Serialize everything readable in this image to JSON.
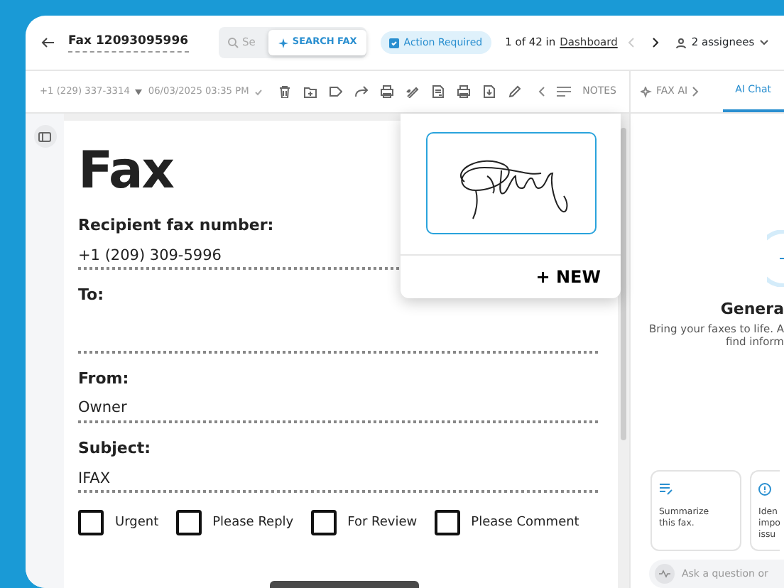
{
  "header": {
    "title": "Fax 12093095996",
    "search": {
      "placeholder": "Se",
      "button": "SEARCH FAX"
    },
    "status_badge": "Action Required",
    "pager": {
      "text": "1 of 42 in",
      "link": "Dashboard",
      "prev_disabled": true,
      "next_disabled": false
    },
    "assignees": "2 assignees"
  },
  "toolbar": {
    "phone": "+1 (229) 337-3314",
    "date": "06/03/2025 03:35 PM",
    "notes": "NOTES"
  },
  "ai_tabs": [
    {
      "label": "FAX AI",
      "selected": false
    },
    {
      "label": "AI Chat",
      "selected": true
    }
  ],
  "document": {
    "title": "Fax",
    "fields": [
      {
        "label": "Recipient fax number:",
        "value": "+1 (209) 309-5996"
      },
      {
        "label": "To:"
      },
      {
        "label": "From:",
        "value": "Owner"
      },
      {
        "label": "Subject:",
        "value": "IFAX"
      }
    ],
    "options": [
      {
        "label": "Urgent",
        "checked": false
      },
      {
        "label": "Please Reply",
        "checked": false
      },
      {
        "label": "For Review",
        "checked": false
      },
      {
        "label": "Please Comment",
        "checked": false
      }
    ]
  },
  "signature_menu": {
    "new_button": "+ NEW"
  },
  "ai_panel": {
    "heading": "Genera",
    "lines": [
      "Bring your faxes to life. A",
      "find inform"
    ],
    "cards": [
      {
        "kind": "summarize",
        "lines": [
          "Summarize",
          "this fax."
        ]
      },
      {
        "kind": "identify",
        "lines": [
          "Iden",
          "impo",
          "issu"
        ]
      }
    ],
    "input_placeholder": "Ask a question or"
  }
}
